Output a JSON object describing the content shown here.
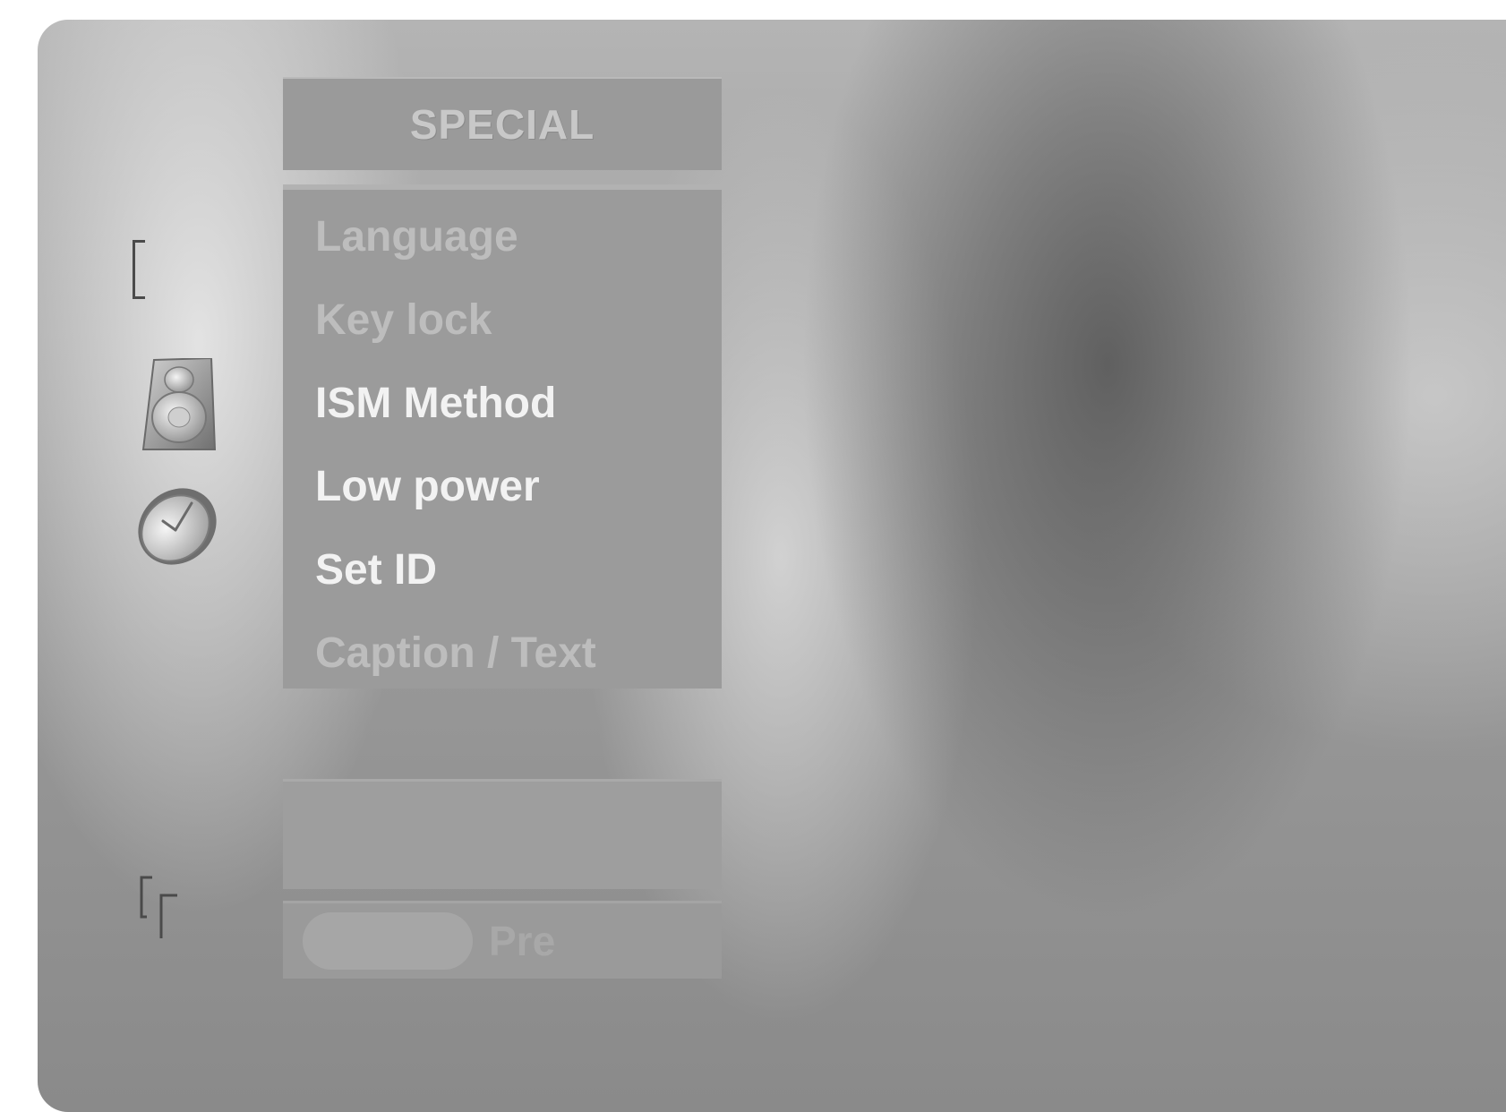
{
  "menu": {
    "title": "SPECIAL",
    "items": [
      {
        "label": "Language",
        "style": "dim"
      },
      {
        "label": "Key lock",
        "style": "dim"
      },
      {
        "label": "ISM Method",
        "style": "bright"
      },
      {
        "label": "Low power",
        "style": "bright"
      },
      {
        "label": "Set ID",
        "style": "bright"
      },
      {
        "label": "Caption / Text",
        "style": "dim"
      }
    ]
  },
  "bottom_bar": {
    "text": "Pre"
  },
  "sidebar": {
    "icons": [
      "bracket-icon",
      "speaker-icon",
      "clock-icon",
      "bracket-icon"
    ]
  }
}
